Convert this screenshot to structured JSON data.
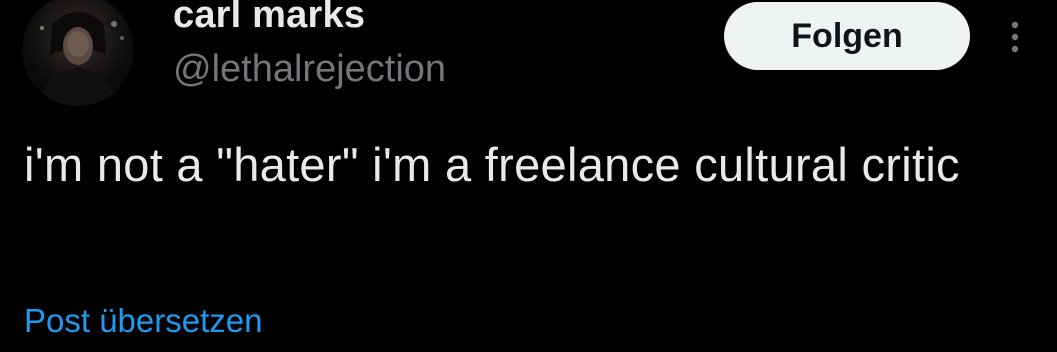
{
  "author": {
    "display_name": "carl marks",
    "handle": "@lethalrejection",
    "avatar_icon": "profile-photo"
  },
  "actions": {
    "follow_label": "Folgen",
    "more_icon": "more-vertical-icon"
  },
  "tweet": {
    "text": "i'm not a \"hater\" i'm a freelance cultural critic",
    "translate_label": "Post übersetzen"
  },
  "colors": {
    "background": "#000000",
    "primary_text": "#e7e9ea",
    "secondary_text": "#71767b",
    "link": "#1d9bf0",
    "follow_bg": "#eff3f4",
    "follow_text": "#0f1419"
  }
}
